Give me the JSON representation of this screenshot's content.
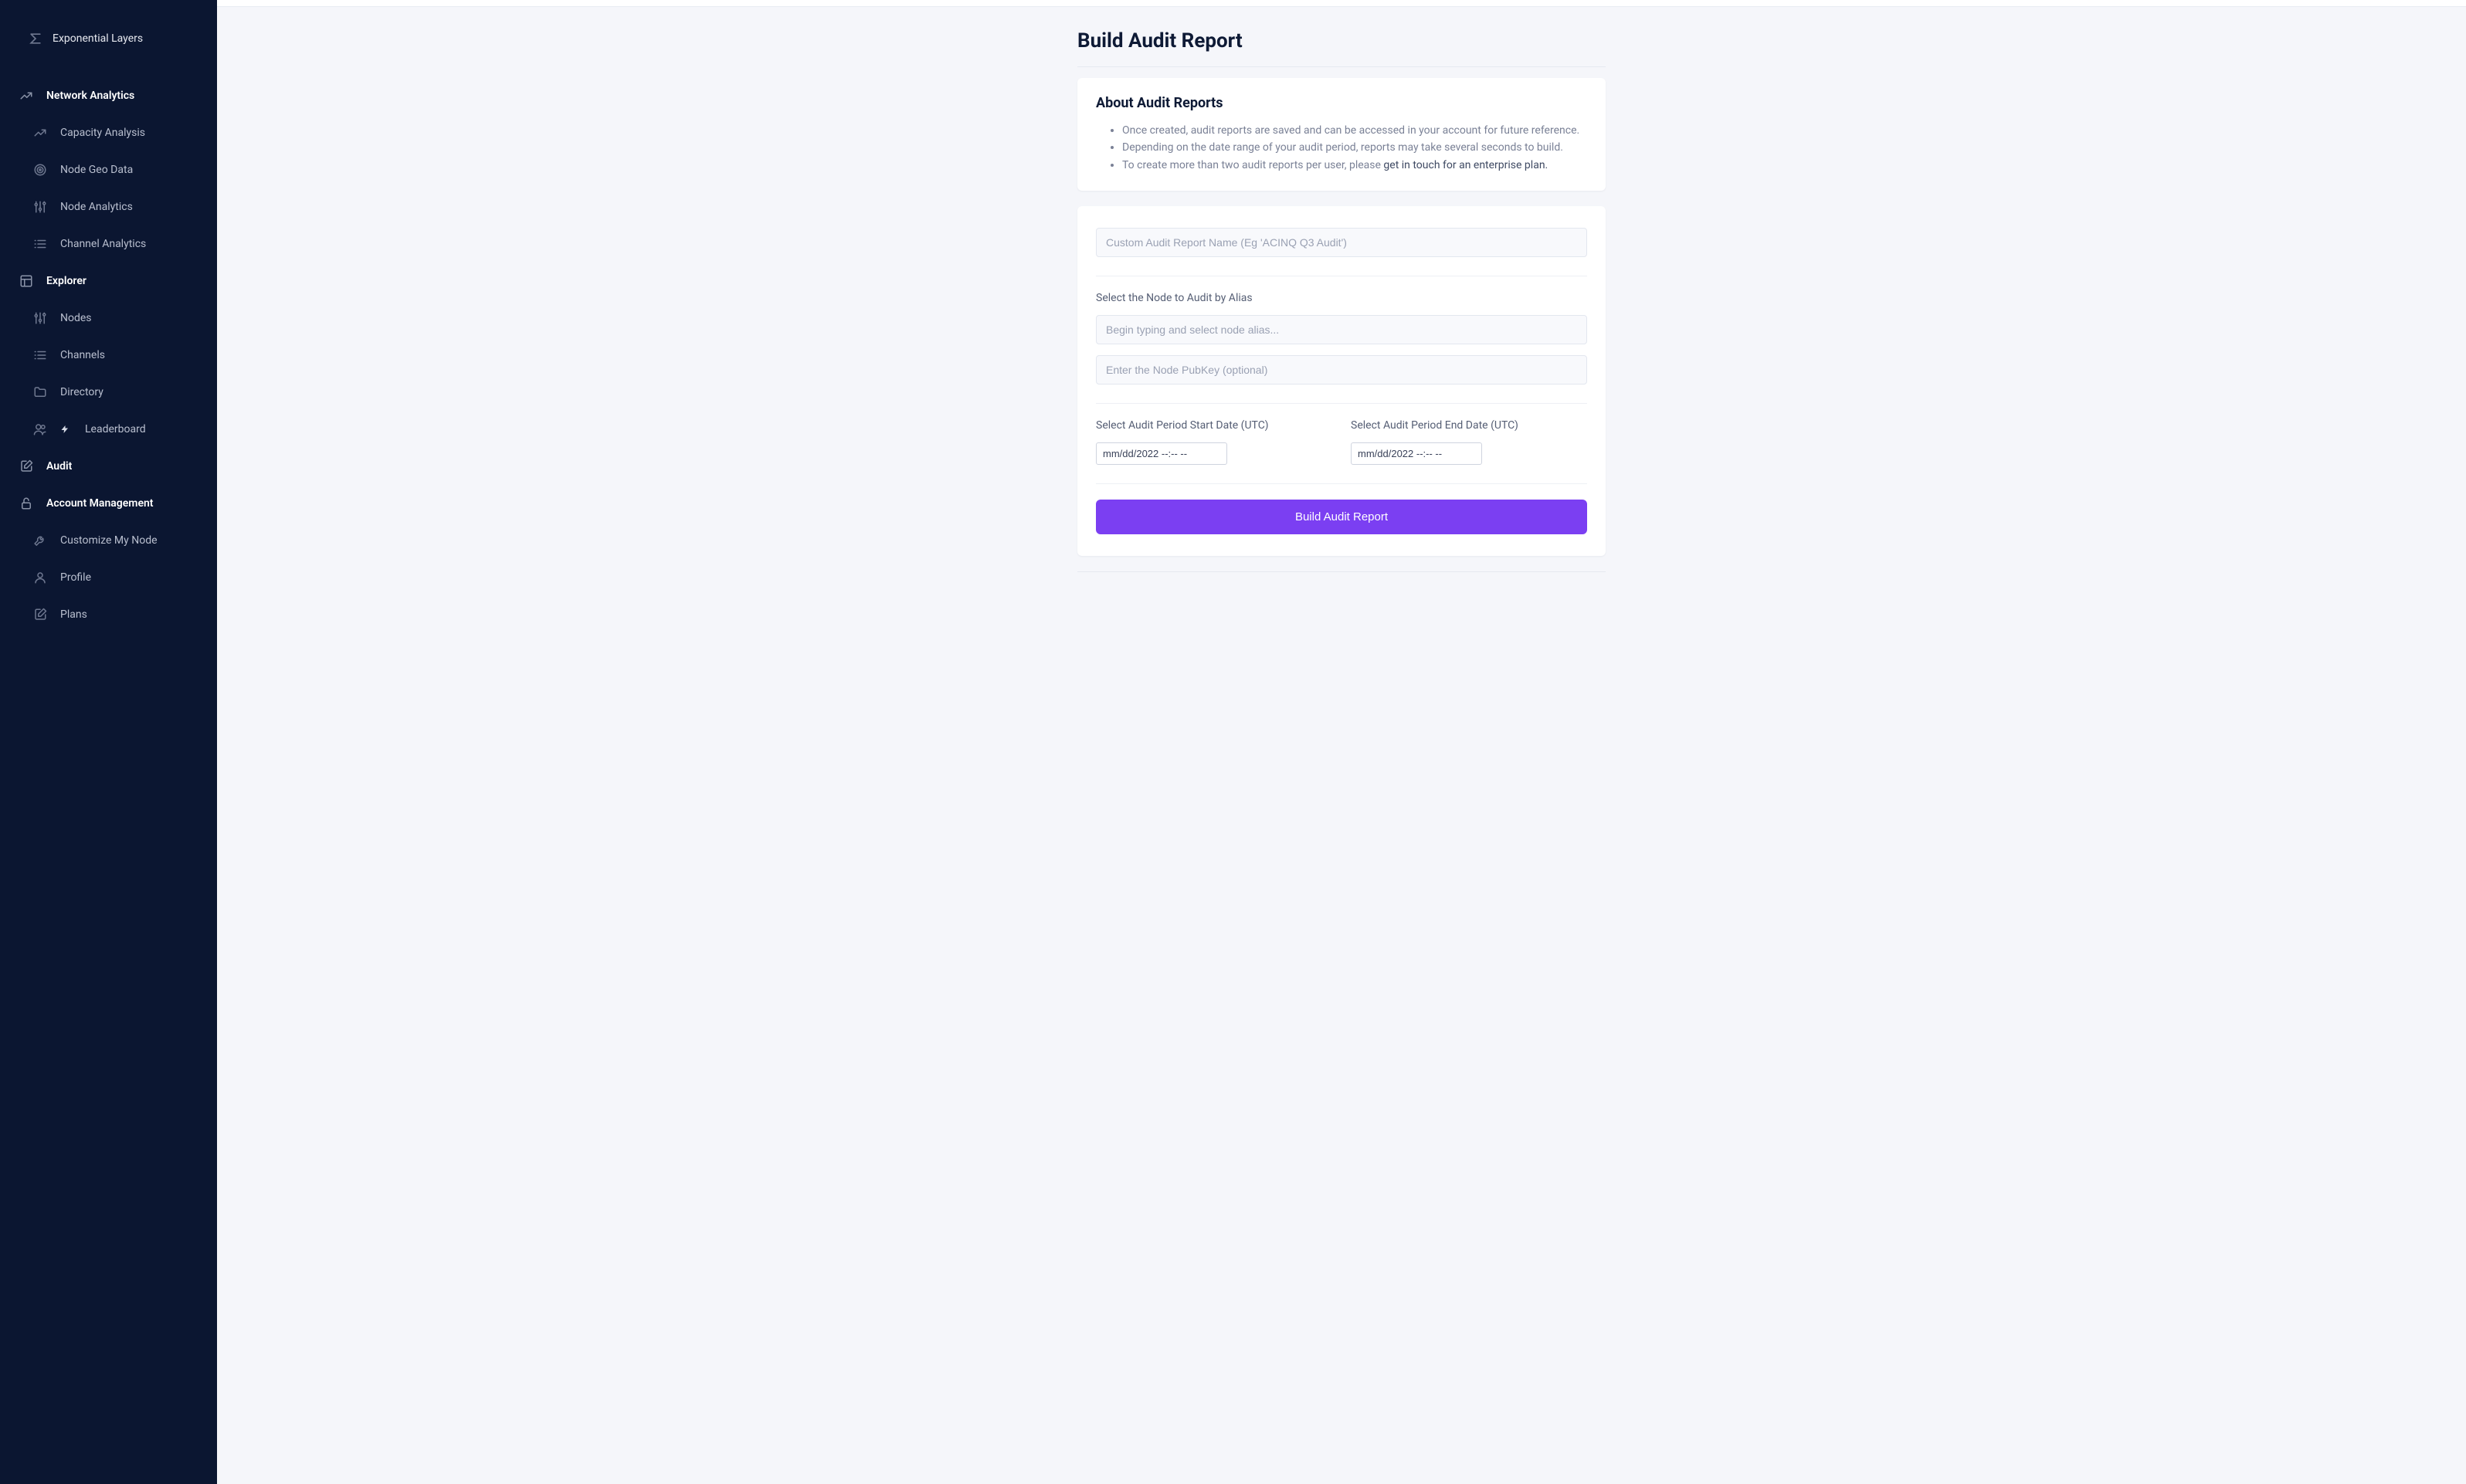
{
  "brand": {
    "name": "Exponential Layers"
  },
  "sidebar": {
    "sections": [
      {
        "title": "Network Analytics",
        "icon": "trend-up-icon",
        "items": [
          {
            "label": "Capacity Analysis",
            "icon": "trend-up-icon"
          },
          {
            "label": "Node Geo Data",
            "icon": "target-icon"
          },
          {
            "label": "Node Analytics",
            "icon": "sliders-icon"
          },
          {
            "label": "Channel Analytics",
            "icon": "list-icon"
          }
        ]
      },
      {
        "title": "Explorer",
        "icon": "layout-icon",
        "items": [
          {
            "label": "Nodes",
            "icon": "sliders-icon"
          },
          {
            "label": "Channels",
            "icon": "list-icon"
          },
          {
            "label": "Directory",
            "icon": "folder-icon"
          },
          {
            "label": "Leaderboard",
            "icon": "users-icon",
            "bolt": true
          }
        ]
      },
      {
        "title": "Audit",
        "icon": "edit-square-icon",
        "items": []
      },
      {
        "title": "Account Management",
        "icon": "lock-icon",
        "items": [
          {
            "label": "Customize My Node",
            "icon": "wrench-icon"
          },
          {
            "label": "Profile",
            "icon": "user-icon"
          },
          {
            "label": "Plans",
            "icon": "edit-square-icon"
          }
        ]
      }
    ]
  },
  "page": {
    "title": "Build Audit Report"
  },
  "about": {
    "title": "About Audit Reports",
    "bullets": [
      "Once created, audit reports are saved and can be accessed in your account for future reference.",
      "Depending on the date range of your audit period, reports may take several seconds to build."
    ],
    "bullet3_prefix": "To create more than two audit reports per user, please ",
    "bullet3_link": "get in touch for an enterprise plan."
  },
  "form": {
    "report_name": {
      "value": "",
      "placeholder": "Custom Audit Report Name (Eg 'ACINQ Q3 Audit')"
    },
    "select_node_label": "Select the Node to Audit by Alias",
    "node_alias": {
      "value": "",
      "placeholder": "Begin typing and select node alias..."
    },
    "node_pubkey": {
      "value": "",
      "placeholder": "Enter the Node PubKey (optional)"
    },
    "start_label": "Select Audit Period Start Date (UTC)",
    "end_label": "Select Audit Period End Date (UTC)",
    "start_date": {
      "display": "mm/dd/2022 --:-- --"
    },
    "end_date": {
      "display": "mm/dd/2022 --:-- --"
    },
    "submit_label": "Build Audit Report"
  }
}
